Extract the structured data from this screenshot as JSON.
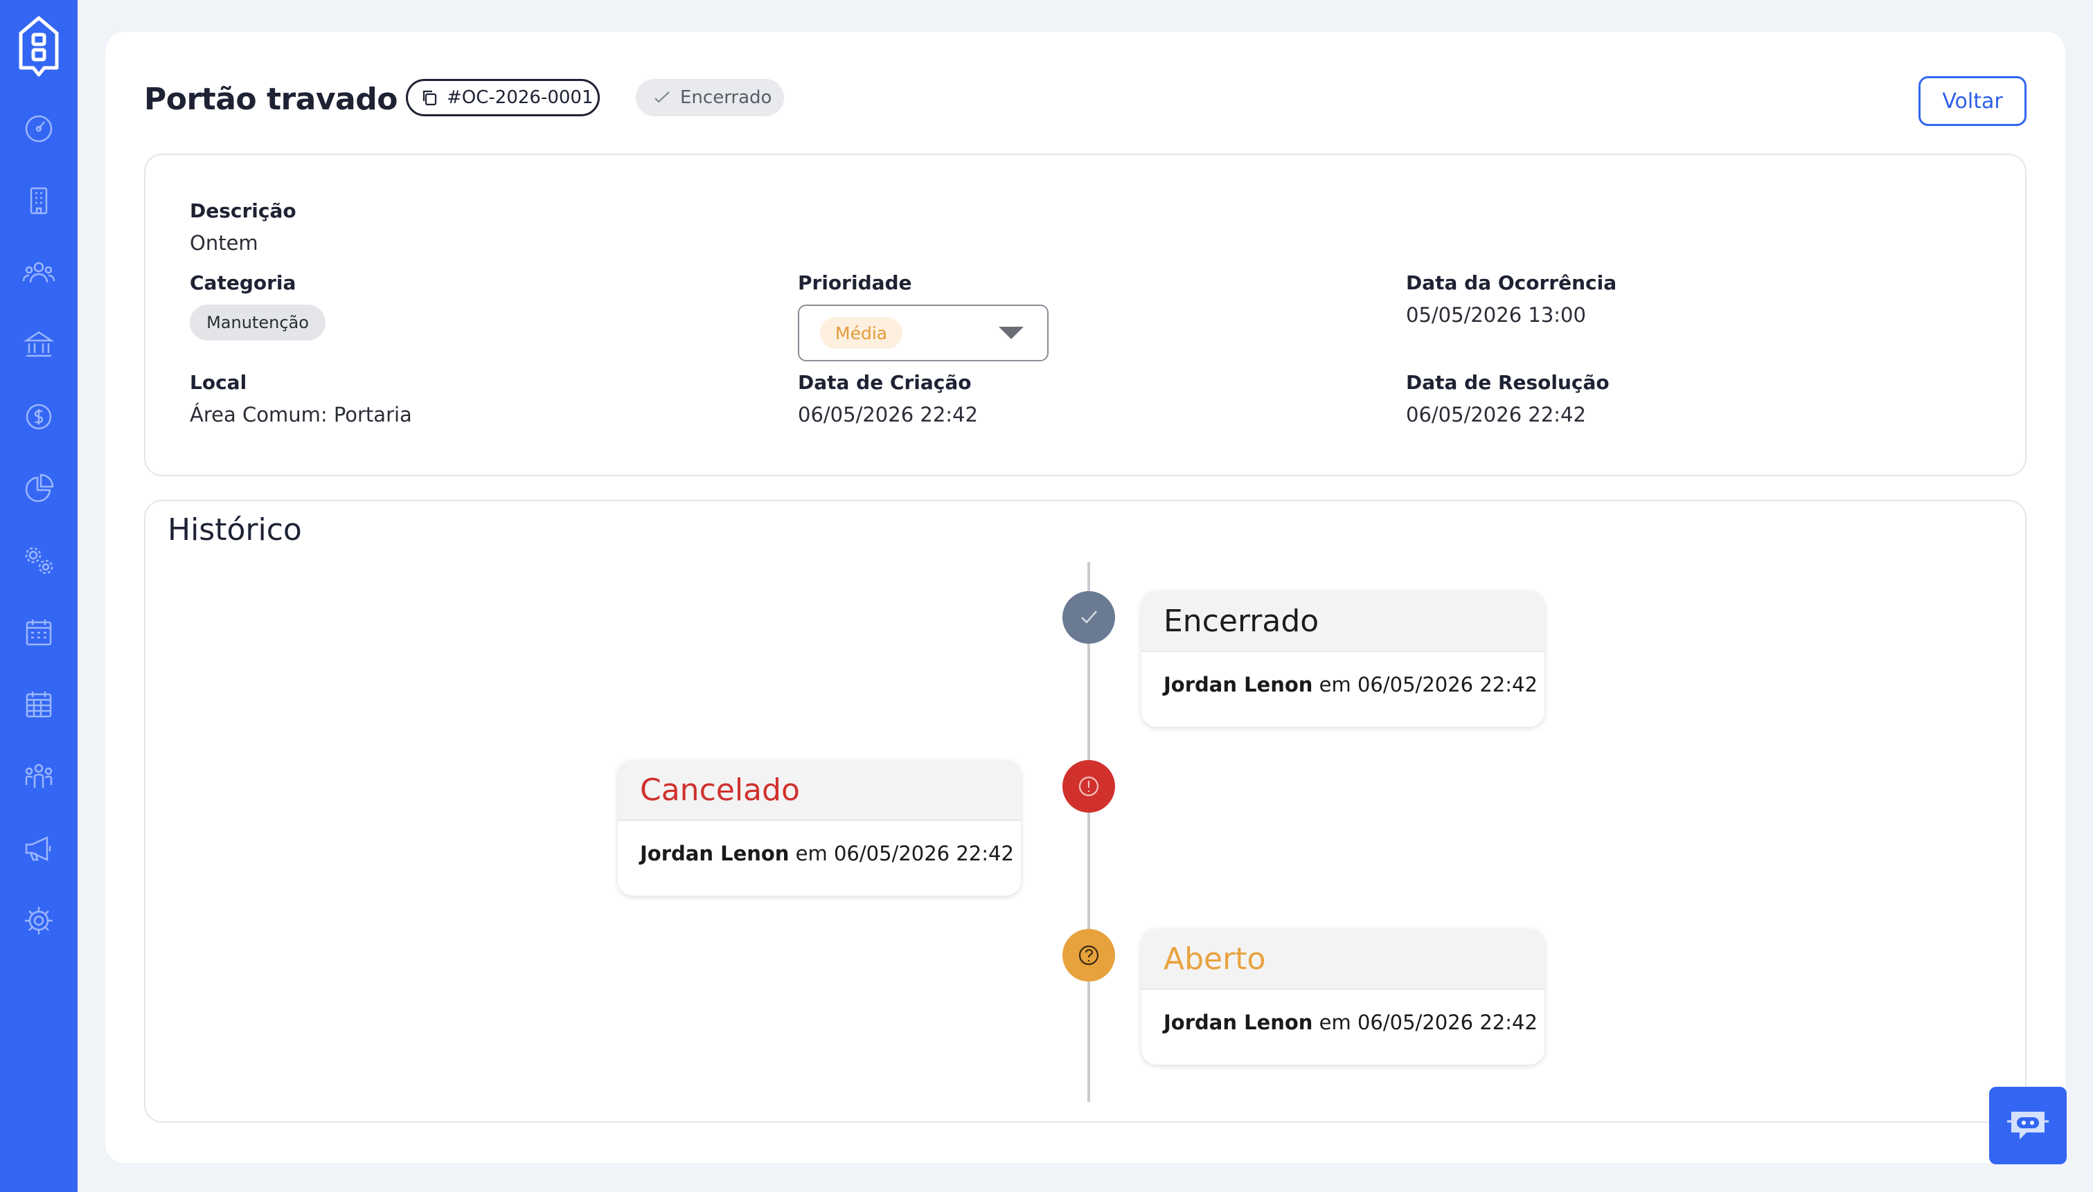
{
  "sidebar": {
    "logo": "building-logo-icon",
    "items": [
      {
        "icon": "dashboard-gauge-icon"
      },
      {
        "icon": "building-icon"
      },
      {
        "icon": "users-group-icon"
      },
      {
        "icon": "bank-icon"
      },
      {
        "icon": "dollar-coin-icon"
      },
      {
        "icon": "pie-chart-icon"
      },
      {
        "icon": "gears-icon"
      },
      {
        "icon": "calendar-icon"
      },
      {
        "icon": "calendar-grid-icon"
      },
      {
        "icon": "people-icon"
      },
      {
        "icon": "megaphone-icon"
      },
      {
        "icon": "settings-gear-icon"
      }
    ]
  },
  "header": {
    "title": "Portão travado",
    "code": "#OC-2026-0001",
    "status": "Encerrado",
    "back_label": "Voltar"
  },
  "details": {
    "description_label": "Descrição",
    "description_value": "Ontem",
    "category_label": "Categoria",
    "category_value": "Manutenção",
    "priority_label": "Prioridade",
    "priority_value": "Média",
    "occurrence_date_label": "Data da Ocorrência",
    "occurrence_date_value": "05/05/2026 13:00",
    "location_label": "Local",
    "location_value": "Área Comum: Portaria",
    "created_label": "Data de Criação",
    "created_value": "06/05/2026 22:42",
    "resolved_label": "Data de Resolução",
    "resolved_value": "06/05/2026 22:42"
  },
  "history": {
    "title": "Histórico",
    "events": [
      {
        "status": "Encerrado",
        "user": "Jordan Lenon",
        "connector": "em",
        "date": "06/05/2026 22:42",
        "color": "#1c1c1c",
        "dot_color": "#6a7a93",
        "icon": "check-icon"
      },
      {
        "status": "Cancelado",
        "user": "Jordan Lenon",
        "connector": "em",
        "date": "06/05/2026 22:42",
        "color": "#d0312d",
        "dot_color": "#d0312d",
        "icon": "alert-icon"
      },
      {
        "status": "Aberto",
        "user": "Jordan Lenon",
        "connector": "em",
        "date": "06/05/2026 22:42",
        "color": "#e8a23d",
        "dot_color": "#e8a23d",
        "icon": "question-icon"
      }
    ]
  },
  "colors": {
    "accent": "#3366f2",
    "priority_medium": "#e39b3a"
  },
  "chat": {
    "icon": "chatbot-icon"
  }
}
